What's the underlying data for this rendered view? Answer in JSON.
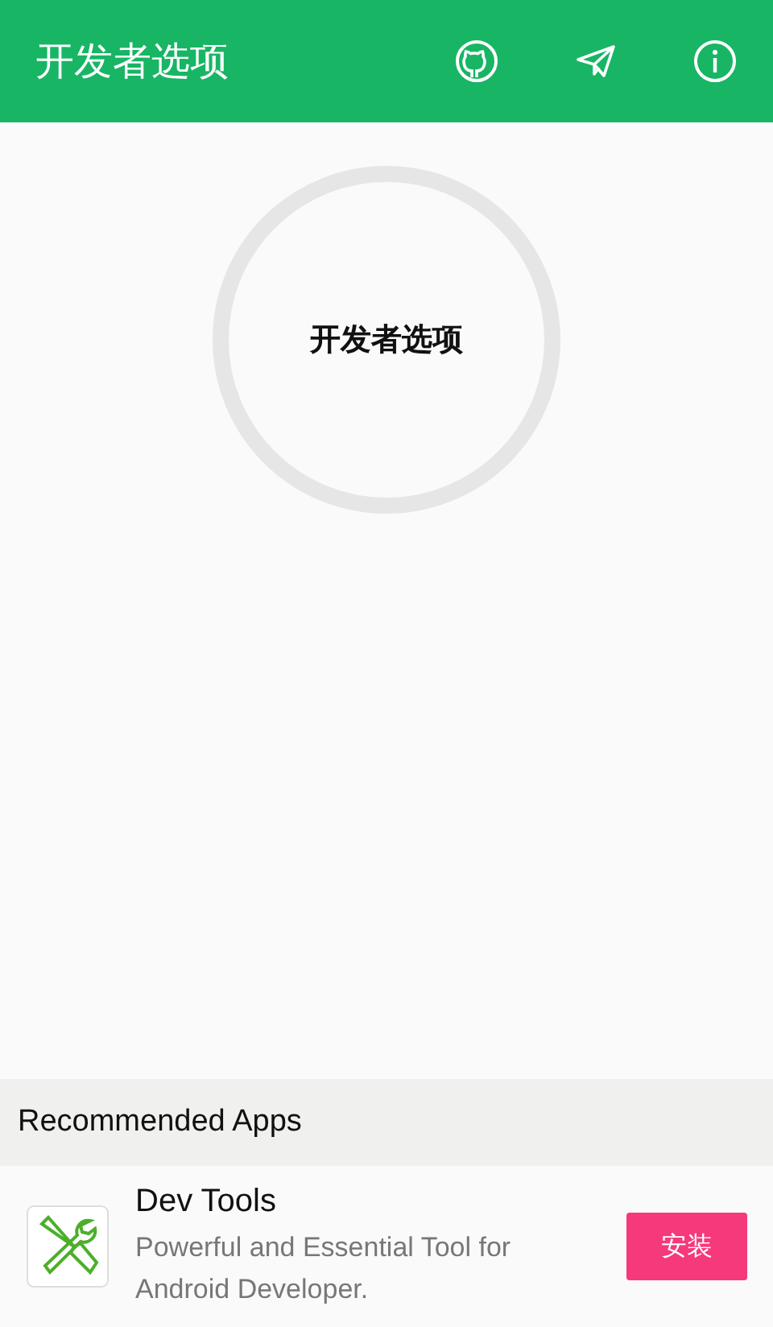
{
  "app_bar": {
    "title": "开发者选项"
  },
  "center_button": {
    "label": "开发者选项"
  },
  "recommended": {
    "heading": "Recommended Apps",
    "apps": [
      {
        "name": "Dev Tools",
        "description": "Powerful and Essential Tool for Android Developer.",
        "action": "安装"
      }
    ]
  }
}
